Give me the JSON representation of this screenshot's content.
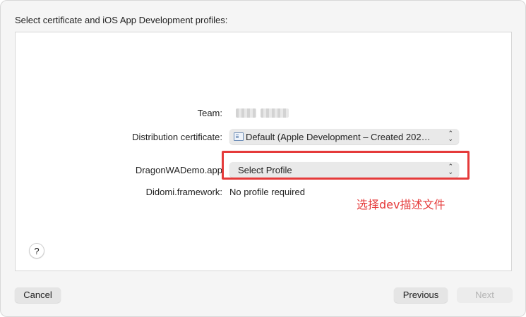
{
  "header": {
    "title": "Select certificate and iOS App Development profiles:"
  },
  "rows": {
    "team": {
      "label": "Team:"
    },
    "distribution": {
      "label": "Distribution certificate:",
      "value": "Default (Apple Development – Created 202…",
      "icon": "certificate-icon"
    },
    "app": {
      "label": "DragonWADemo.app",
      "value": "Select Profile"
    },
    "framework": {
      "label": "Didomi.framework:",
      "value": "No profile required"
    }
  },
  "annotation": {
    "text": "选择dev描述文件",
    "color": "#e53a3a"
  },
  "help": {
    "label": "?"
  },
  "footer": {
    "cancel": "Cancel",
    "previous": "Previous",
    "next": "Next"
  }
}
